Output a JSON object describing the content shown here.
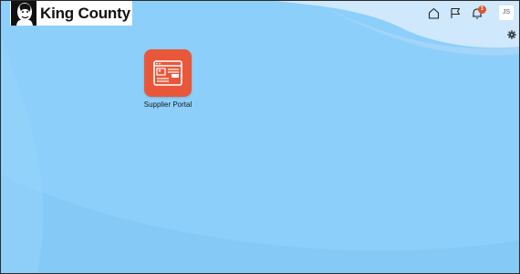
{
  "header": {
    "logo_text": "King County",
    "notification_count": "1",
    "user_initials": "JS",
    "icons": [
      "home-icon",
      "flag-icon",
      "bell-icon",
      "gear-icon"
    ]
  },
  "apps": [
    {
      "label": "Supplier Portal",
      "icon": "supplier-portal-icon",
      "color": "#e8573a"
    }
  ],
  "colors": {
    "background": "#8ccffb",
    "wave_light": "#cfe8fb",
    "accent": "#e8573a"
  }
}
